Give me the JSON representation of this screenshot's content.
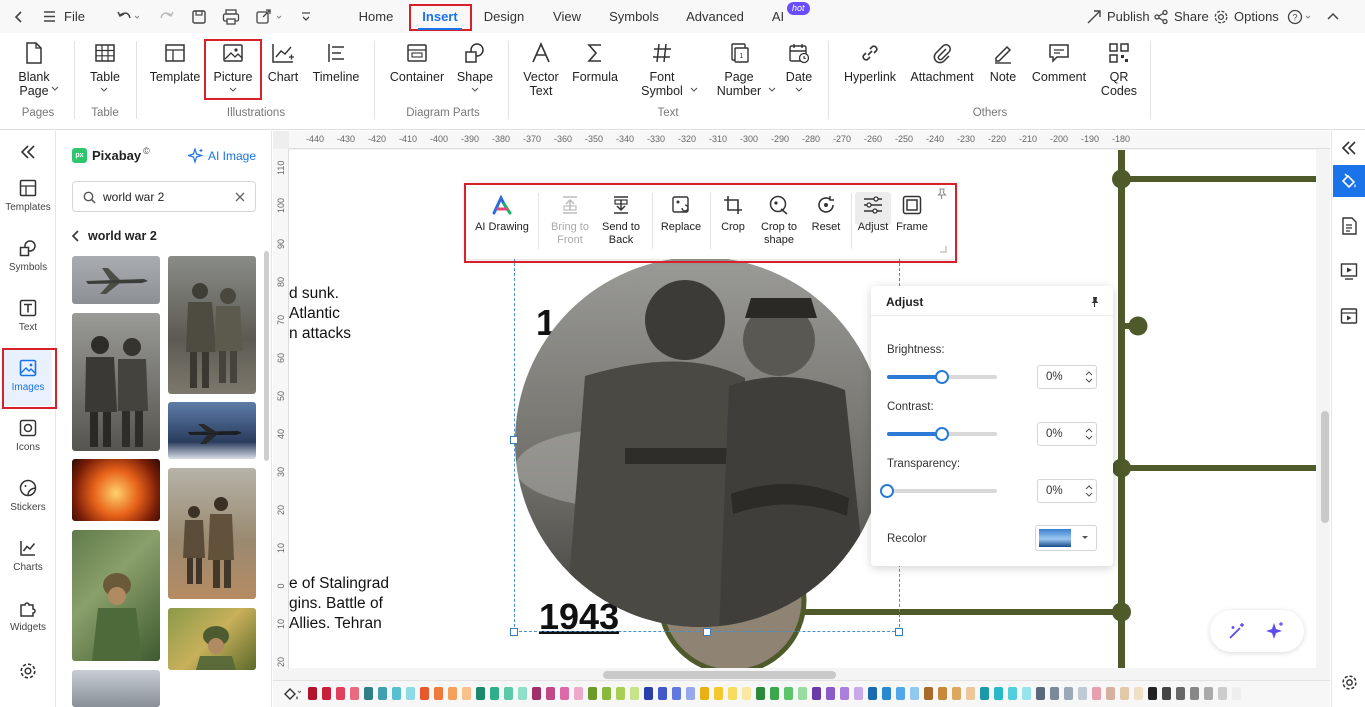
{
  "titlebar": {
    "file": "File",
    "tabs": [
      "Home",
      "Insert",
      "Design",
      "View",
      "Symbols",
      "Advanced",
      "AI"
    ],
    "hot_badge": "hot",
    "publish": "Publish",
    "share": "Share",
    "options": "Options",
    "help": "?"
  },
  "ribbon": {
    "buttons": {
      "blank_page": [
        "Blank",
        "Page"
      ],
      "table": "Table",
      "template": "Template",
      "picture": "Picture",
      "chart": "Chart",
      "timeline": "Timeline",
      "container": "Container",
      "shape": "Shape",
      "vector_text": [
        "Vector",
        "Text"
      ],
      "formula": "Formula",
      "font_symbol": [
        "Font",
        "Symbol"
      ],
      "page_number": [
        "Page",
        "Number"
      ],
      "date": "Date",
      "hyperlink": "Hyperlink",
      "attachment": "Attachment",
      "note": "Note",
      "comment": "Comment",
      "qr_codes": [
        "QR",
        "Codes"
      ]
    },
    "groups": {
      "pages": "Pages",
      "table": "Table",
      "illustrations": "Illustrations",
      "diagram_parts": "Diagram Parts",
      "text": "Text",
      "others": "Others"
    }
  },
  "leftbar": {
    "items": [
      "Templates",
      "Symbols",
      "Text",
      "Images",
      "Icons",
      "Stickers",
      "Charts",
      "Widgets"
    ]
  },
  "library": {
    "source": "Pixabay",
    "source_mark": "©",
    "ai_image": "AI Image",
    "search_value": "world war 2",
    "breadcrumb": "world war 2"
  },
  "ruler": {
    "top_ticks": [
      "-440",
      "-430",
      "-420",
      "-410",
      "-400",
      "-390",
      "-380",
      "-370",
      "-360",
      "-350",
      "-340",
      "-330",
      "-320",
      "-310",
      "-300",
      "-290",
      "-280",
      "-270",
      "-260",
      "-250",
      "-240",
      "-230",
      "-220",
      "-210",
      "-200",
      "-190",
      "-180"
    ],
    "left_ticks": [
      "110",
      "100",
      "90",
      "80",
      "70",
      "60",
      "50",
      "40",
      "30",
      "20",
      "10",
      "0",
      "10",
      "20"
    ]
  },
  "context_toolbar": {
    "ai_drawing": "AI Drawing",
    "bring_to_front": [
      "Bring to",
      "Front"
    ],
    "send_to_back": [
      "Send to",
      "Back"
    ],
    "replace": "Replace",
    "crop": "Crop",
    "crop_to_shape": [
      "Crop to",
      "shape"
    ],
    "reset": "Reset",
    "adjust": "Adjust",
    "frame": "Frame"
  },
  "canvas_text": {
    "top_lines": [
      "d sunk.",
      "Atlantic",
      "n attacks"
    ],
    "year_top": "1",
    "bottom_lines": [
      "e of Stalingrad",
      "gins. Battle of",
      "Allies. Tehran"
    ],
    "year_bottom": "1943"
  },
  "adjust_panel": {
    "title": "Adjust",
    "brightness_label": "Brightness:",
    "brightness_value": "0%",
    "brightness_level": 0.5,
    "contrast_label": "Contrast:",
    "contrast_value": "0%",
    "contrast_level": 0.5,
    "transparency_label": "Transparency:",
    "transparency_value": "0%",
    "transparency_level": 0,
    "recolor_label": "Recolor"
  },
  "colors": {
    "accent": "#1a73e8",
    "highlight_box": "#d8202a",
    "timeline_green": "#4e5a2a",
    "swatches": [
      "#b0132b",
      "#c8203a",
      "#e0405a",
      "#e86a80",
      "#2e7f8a",
      "#3fa0b0",
      "#55c0d0",
      "#8cdbe6",
      "#e8582a",
      "#f07a3a",
      "#f5a05a",
      "#f8c08a",
      "#1a8a6a",
      "#2fae8a",
      "#5ccaa8",
      "#8fe0c8",
      "#a0306a",
      "#c04888",
      "#dc6aa8",
      "#ecaac8",
      "#6a9a2a",
      "#8ab83a",
      "#a8d050",
      "#c8e488",
      "#2a40a8",
      "#4058c8",
      "#6078e0",
      "#98a8ec",
      "#e8b010",
      "#f5c830",
      "#f8dc60",
      "#fbe8a0",
      "#2a8a3a",
      "#3aa84a",
      "#5cc46a",
      "#98dca0",
      "#6a3aa8",
      "#8a58c8",
      "#a880dc",
      "#c8aaec",
      "#1a6ab0",
      "#2888d0",
      "#50a8e8",
      "#90c8f0",
      "#a86a2a",
      "#c8883a",
      "#dca860",
      "#ecc898",
      "#1a9aa8",
      "#28b8c8",
      "#50d0dc",
      "#98e4ec",
      "#5a6a7a",
      "#7a8a9a",
      "#9aa8b8",
      "#c0cad4",
      "#e8a0b0",
      "#d8b0a0",
      "#e0c8a8",
      "#f0e0c8",
      "#222222",
      "#444444",
      "#666666",
      "#888888",
      "#aaaaaa",
      "#cccccc",
      "#eeeeee"
    ]
  }
}
